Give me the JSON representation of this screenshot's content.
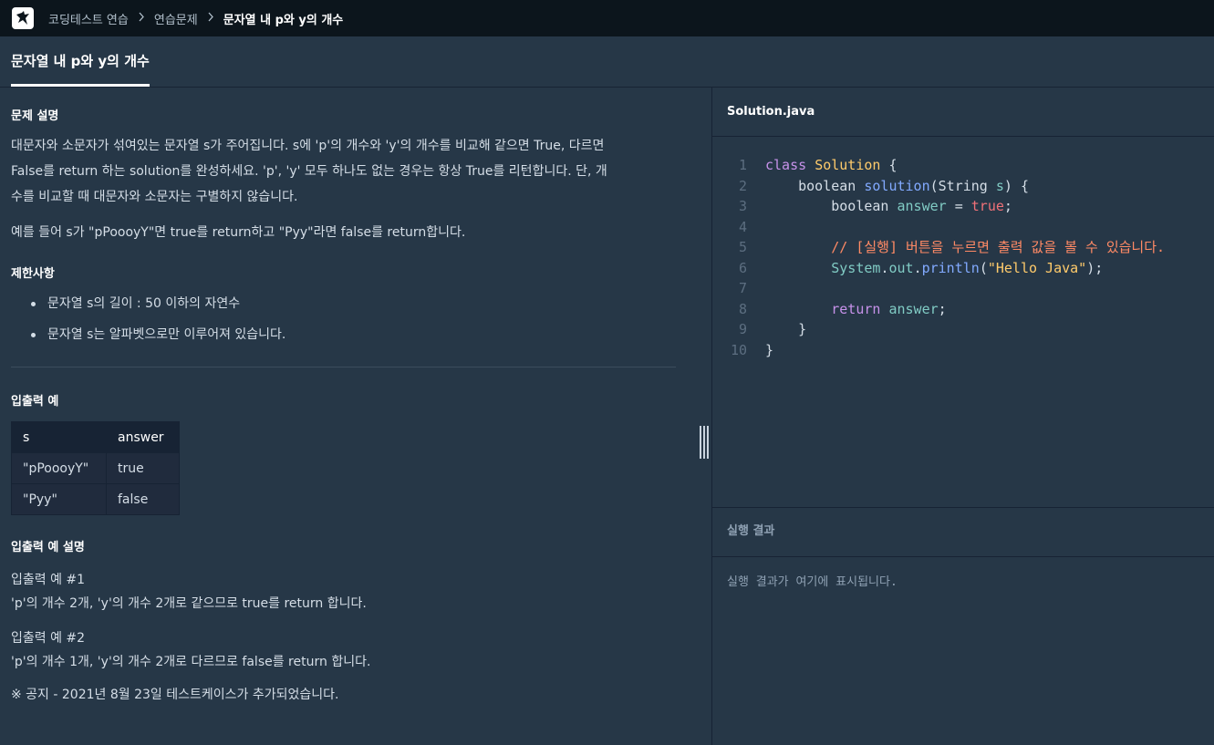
{
  "nav": {
    "logo_icon": "programmers-logo-icon",
    "breadcrumbs": [
      "코딩테스트 연습",
      "연습문제",
      "문자열 내 p와 y의 개수"
    ]
  },
  "title_tab": "문자열 내 p와 y의 개수",
  "problem": {
    "desc_heading": "문제 설명",
    "desc_1": "대문자와 소문자가 섞여있는 문자열 s가 주어집니다. s에 'p'의 개수와 'y'의 개수를 비교해 같으면 True, 다르면",
    "desc_2": "False를 return 하는 solution를 완성하세요. 'p', 'y' 모두 하나도 없는 경우는 항상 True를 리턴합니다. 단, 개",
    "desc_3": "수를 비교할 때 대문자와 소문자는 구별하지 않습니다.",
    "example_text": "예를 들어 s가 \"pPoooyY\"면 true를 return하고 \"Pyy\"라면 false를 return합니다.",
    "constraints_heading": "제한사항",
    "constraints": [
      "문자열 s의 길이 : 50 이하의 자연수",
      "문자열 s는 알파벳으로만 이루어져 있습니다."
    ],
    "io_heading": "입출력 예",
    "io_table": {
      "headers": [
        "s",
        "answer"
      ],
      "rows": [
        [
          "\"pPoooyY\"",
          "true"
        ],
        [
          "\"Pyy\"",
          "false"
        ]
      ]
    },
    "io_desc_heading": "입출력 예 설명",
    "io_ex1_title": "입출력 예 #1",
    "io_ex1_text": "'p'의 개수 2개, 'y'의 개수 2개로 같으므로 true를 return 합니다.",
    "io_ex2_title": "입출력 예 #2",
    "io_ex2_text": "'p'의 개수 1개, 'y'의 개수 2개로 다르므로 false를 return 합니다.",
    "notice": "※ 공지 - 2021년 8월 23일 테스트케이스가 추가되었습니다."
  },
  "editor": {
    "file_name": "Solution.java",
    "line_numbers": [
      "1",
      "2",
      "3",
      "4",
      "5",
      "6",
      "7",
      "8",
      "9",
      "10"
    ],
    "tokens": {
      "class_kw": "class",
      "class_name": "Solution",
      "open_brace": " {",
      "boolean_kw": "boolean",
      "method_name": "solution",
      "params_open": "(String ",
      "param_s": "s",
      "params_close": ") {",
      "answer_var": "answer",
      "assign": " = ",
      "true_lit": "true",
      "semi": ";",
      "comment": "// [실행] 버튼을 누르면 출력 값을 볼 수 있습니다.",
      "system": "System",
      "dot": ".",
      "out": "out",
      "println": "println",
      "paren_open": "(",
      "hello_str": "\"Hello Java\"",
      "paren_close": ");",
      "return_kw": "return",
      "close_brace": "}"
    }
  },
  "result": {
    "heading": "실행 결과",
    "placeholder": "실행 결과가 여기에 표시됩니다."
  }
}
